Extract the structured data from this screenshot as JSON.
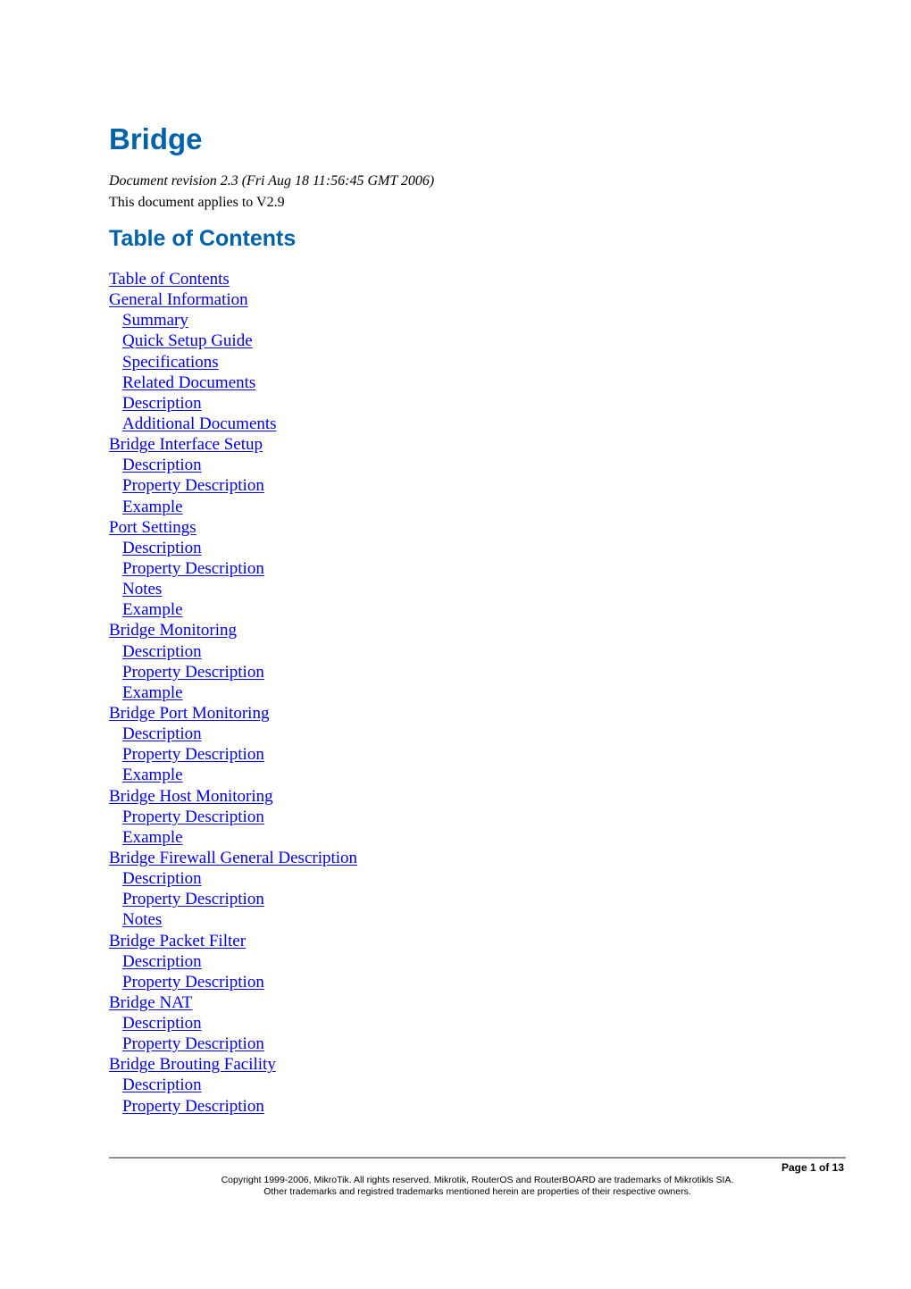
{
  "document": {
    "title": "Bridge",
    "revision": "Document revision 2.3 (Fri Aug 18 11:56:45 GMT 2006)",
    "applies_to": "This document applies to V2.9"
  },
  "toc": {
    "heading": "Table of Contents",
    "items": [
      {
        "label": "Table of Contents",
        "level": 1
      },
      {
        "label": "General Information",
        "level": 1
      },
      {
        "label": "Summary",
        "level": 2
      },
      {
        "label": "Quick Setup Guide",
        "level": 2
      },
      {
        "label": "Specifications",
        "level": 2
      },
      {
        "label": "Related Documents",
        "level": 2
      },
      {
        "label": "Description",
        "level": 2
      },
      {
        "label": "Additional Documents",
        "level": 2
      },
      {
        "label": "Bridge Interface Setup",
        "level": 1
      },
      {
        "label": "Description",
        "level": 2
      },
      {
        "label": "Property Description",
        "level": 2
      },
      {
        "label": "Example",
        "level": 2
      },
      {
        "label": "Port Settings",
        "level": 1
      },
      {
        "label": "Description",
        "level": 2
      },
      {
        "label": "Property Description",
        "level": 2
      },
      {
        "label": "Notes",
        "level": 2
      },
      {
        "label": "Example",
        "level": 2
      },
      {
        "label": "Bridge Monitoring",
        "level": 1
      },
      {
        "label": "Description",
        "level": 2
      },
      {
        "label": "Property Description",
        "level": 2
      },
      {
        "label": "Example",
        "level": 2
      },
      {
        "label": "Bridge Port Monitoring",
        "level": 1
      },
      {
        "label": "Description",
        "level": 2
      },
      {
        "label": "Property Description",
        "level": 2
      },
      {
        "label": "Example",
        "level": 2
      },
      {
        "label": "Bridge Host Monitoring",
        "level": 1
      },
      {
        "label": "Property Description",
        "level": 2
      },
      {
        "label": "Example",
        "level": 2
      },
      {
        "label": "Bridge Firewall General Description",
        "level": 1
      },
      {
        "label": "Description",
        "level": 2
      },
      {
        "label": "Property Description",
        "level": 2
      },
      {
        "label": "Notes",
        "level": 2
      },
      {
        "label": "Bridge Packet Filter",
        "level": 1
      },
      {
        "label": "Description",
        "level": 2
      },
      {
        "label": "Property Description",
        "level": 2
      },
      {
        "label": "Bridge NAT",
        "level": 1
      },
      {
        "label": "Description",
        "level": 2
      },
      {
        "label": "Property Description",
        "level": 2
      },
      {
        "label": "Bridge Brouting Facility",
        "level": 1
      },
      {
        "label": "Description",
        "level": 2
      },
      {
        "label": "Property Description",
        "level": 2
      }
    ]
  },
  "footer": {
    "page_number": "Page 1 of 13",
    "copyright_line1": "Copyright 1999-2006, MikroTik. All rights reserved. Mikrotik, RouterOS and RouterBOARD are trademarks of Mikrotikls SIA.",
    "copyright_line2": "Other trademarks and registred trademarks mentioned herein are properties of their respective owners."
  },
  "colors": {
    "heading": "#0062a8",
    "link": "#0000ee",
    "rule": "#8c8c8c"
  }
}
